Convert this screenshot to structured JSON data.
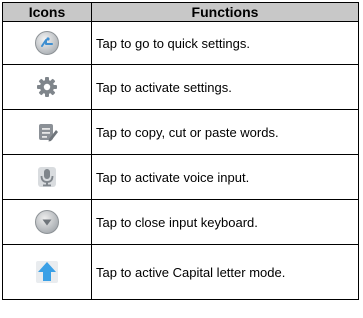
{
  "table": {
    "headers": {
      "icons": "Icons",
      "functions": "Functions"
    },
    "rows": [
      {
        "icon": "quick-settings-icon",
        "text": "Tap to go to quick settings."
      },
      {
        "icon": "gear-icon",
        "text": "Tap to activate settings."
      },
      {
        "icon": "edit-words-icon",
        "text": "Tap to copy, cut or paste words."
      },
      {
        "icon": "microphone-icon",
        "text": "Tap to activate voice input."
      },
      {
        "icon": "hide-keyboard-icon",
        "text": "Tap to close input keyboard."
      },
      {
        "icon": "shift-arrow-icon",
        "text": "Tap to active Capital letter mode."
      }
    ]
  },
  "colors": {
    "header_background": "#c8c8c8",
    "border": "#000000",
    "shift_icon": "#3aa0e6"
  }
}
